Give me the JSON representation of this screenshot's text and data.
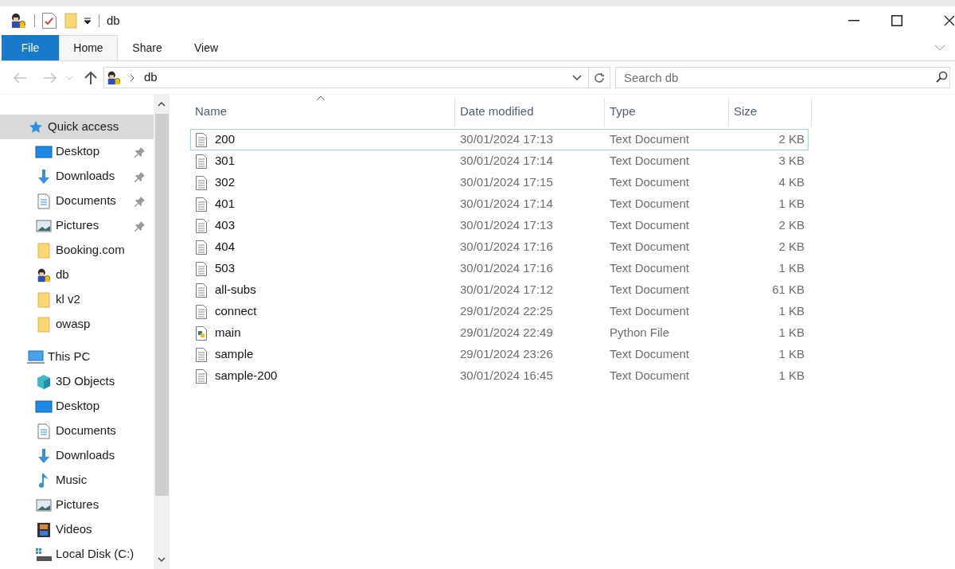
{
  "window": {
    "title": "db"
  },
  "ribbon": {
    "tabs": [
      {
        "label": "File",
        "selected": false,
        "kind": "file"
      },
      {
        "label": "Home",
        "selected": true,
        "kind": "tab"
      },
      {
        "label": "Share",
        "selected": false,
        "kind": "tab"
      },
      {
        "label": "View",
        "selected": false,
        "kind": "tab"
      }
    ]
  },
  "address_bar": {
    "path": "db"
  },
  "search": {
    "placeholder": "Search db"
  },
  "sidebar": {
    "items": [
      {
        "label": "Quick access",
        "kind": "star",
        "selected": true,
        "children": [
          {
            "label": "Desktop",
            "kind": "desktop",
            "selected": false,
            "pinned": true
          },
          {
            "label": "Downloads",
            "kind": "downloads",
            "selected": false,
            "pinned": true
          },
          {
            "label": "Documents",
            "kind": "documents",
            "selected": false,
            "pinned": true
          },
          {
            "label": "Pictures",
            "kind": "pictures",
            "selected": false,
            "pinned": true
          },
          {
            "label": "Booking.com",
            "kind": "folder",
            "selected": false,
            "pinned": false
          },
          {
            "label": "db",
            "kind": "app",
            "selected": false,
            "pinned": false
          },
          {
            "label": "kl v2",
            "kind": "folder",
            "selected": false,
            "pinned": false
          },
          {
            "label": "owasp",
            "kind": "folder",
            "selected": false,
            "pinned": false
          }
        ]
      },
      {
        "label": "This PC",
        "kind": "pc",
        "selected": false,
        "children": [
          {
            "label": "3D Objects",
            "kind": "objects",
            "selected": false,
            "pinned": false
          },
          {
            "label": "Desktop",
            "kind": "desktop",
            "selected": false,
            "pinned": false
          },
          {
            "label": "Documents",
            "kind": "documents",
            "selected": false,
            "pinned": false
          },
          {
            "label": "Downloads",
            "kind": "downloads",
            "selected": false,
            "pinned": false
          },
          {
            "label": "Music",
            "kind": "music",
            "selected": false,
            "pinned": false
          },
          {
            "label": "Pictures",
            "kind": "pictures",
            "selected": false,
            "pinned": false
          },
          {
            "label": "Videos",
            "kind": "videos",
            "selected": false,
            "pinned": false
          },
          {
            "label": "Local Disk (C:)",
            "kind": "disk",
            "selected": false,
            "pinned": false
          }
        ]
      }
    ]
  },
  "table": {
    "columns": [
      "Name",
      "Date modified",
      "Type",
      "Size"
    ],
    "rows": [
      {
        "name": "200",
        "date": "30/01/2024 17:13",
        "type": "Text Document",
        "size": "2 KB",
        "kind": "text",
        "selected": true
      },
      {
        "name": "301",
        "date": "30/01/2024 17:14",
        "type": "Text Document",
        "size": "3 KB",
        "kind": "text",
        "selected": false
      },
      {
        "name": "302",
        "date": "30/01/2024 17:15",
        "type": "Text Document",
        "size": "4 KB",
        "kind": "text",
        "selected": false
      },
      {
        "name": "401",
        "date": "30/01/2024 17:14",
        "type": "Text Document",
        "size": "1 KB",
        "kind": "text",
        "selected": false
      },
      {
        "name": "403",
        "date": "30/01/2024 17:13",
        "type": "Text Document",
        "size": "2 KB",
        "kind": "text",
        "selected": false
      },
      {
        "name": "404",
        "date": "30/01/2024 17:16",
        "type": "Text Document",
        "size": "2 KB",
        "kind": "text",
        "selected": false
      },
      {
        "name": "503",
        "date": "30/01/2024 17:16",
        "type": "Text Document",
        "size": "1 KB",
        "kind": "text",
        "selected": false
      },
      {
        "name": "all-subs",
        "date": "30/01/2024 17:12",
        "type": "Text Document",
        "size": "61 KB",
        "kind": "text",
        "selected": false
      },
      {
        "name": "connect",
        "date": "29/01/2024 22:25",
        "type": "Text Document",
        "size": "1 KB",
        "kind": "text",
        "selected": false
      },
      {
        "name": "main",
        "date": "29/01/2024 22:49",
        "type": "Python File",
        "size": "1 KB",
        "kind": "python",
        "selected": false
      },
      {
        "name": "sample",
        "date": "29/01/2024 23:26",
        "type": "Text Document",
        "size": "1 KB",
        "kind": "text",
        "selected": false
      },
      {
        "name": "sample-200",
        "date": "30/01/2024 16:45",
        "type": "Text Document",
        "size": "1 KB",
        "kind": "text",
        "selected": false
      }
    ]
  }
}
